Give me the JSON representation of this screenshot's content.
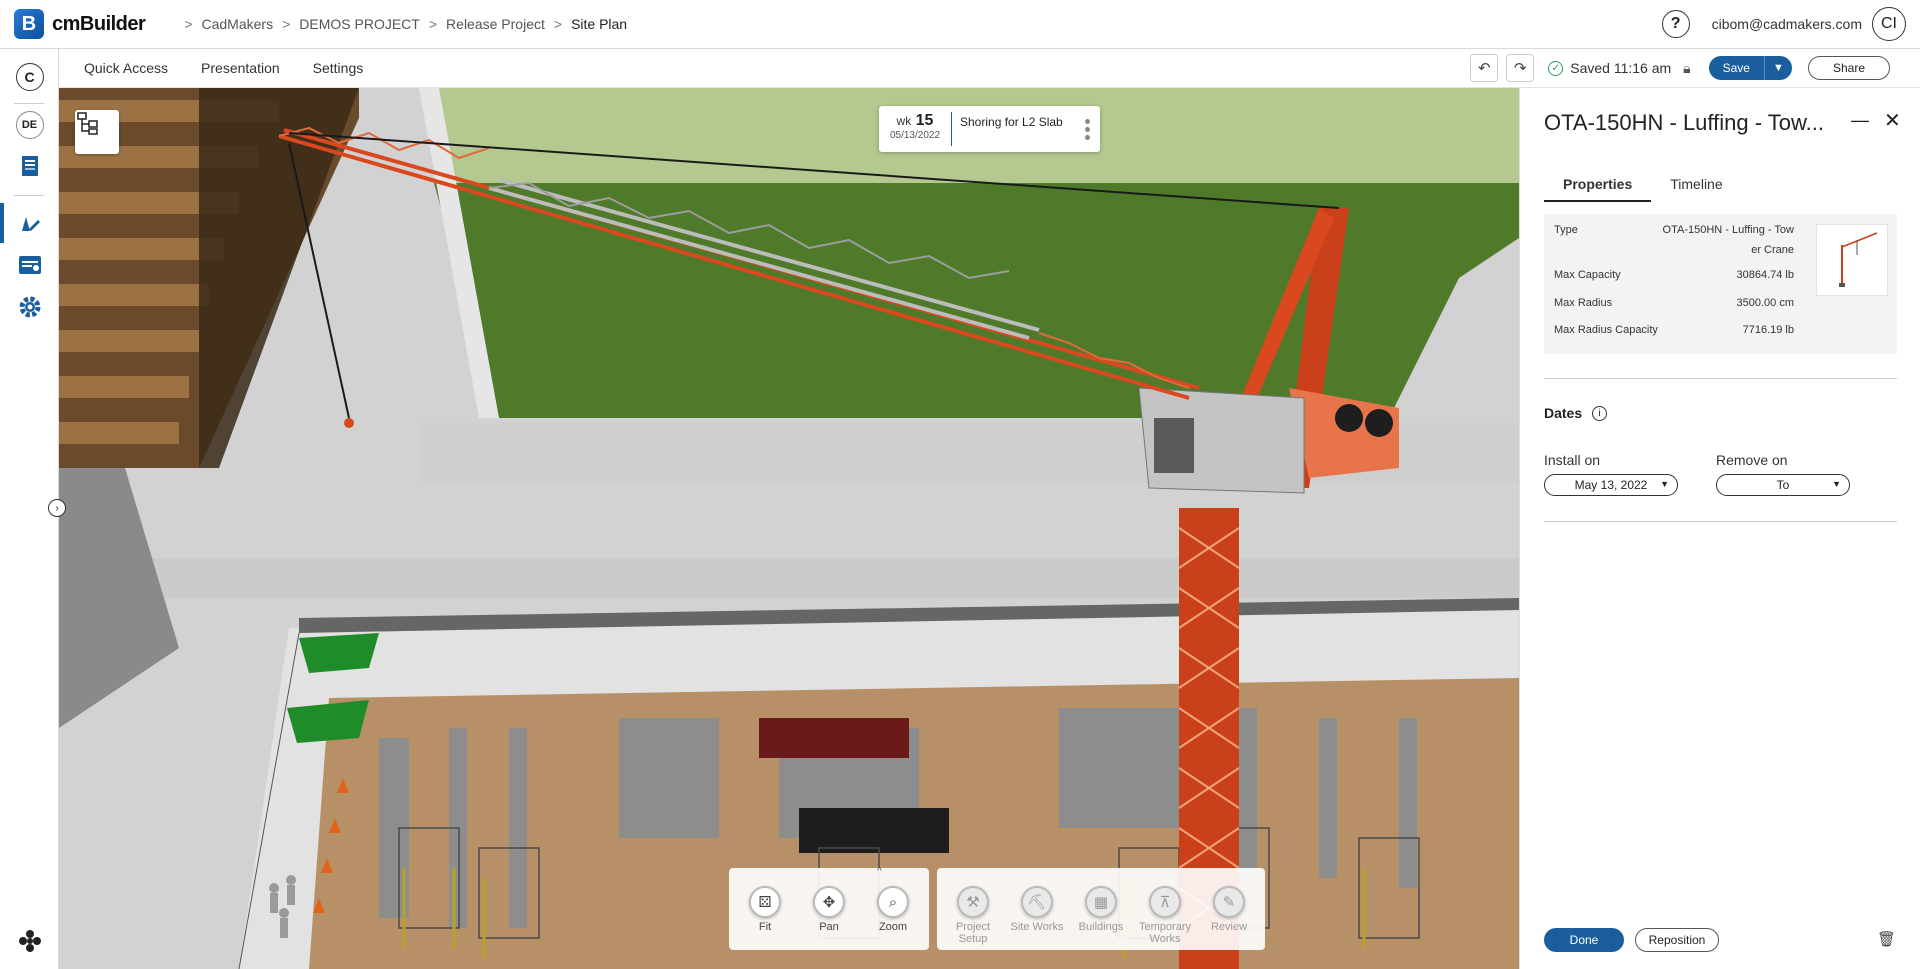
{
  "app": {
    "logo_letter": "B",
    "name": "cmBuilder"
  },
  "breadcrumb": [
    "CadMakers",
    "DEMOS PROJECT",
    "Release Project",
    "Site Plan"
  ],
  "user": {
    "email": "cibom@cadmakers.com",
    "initials": "CI",
    "help": "?"
  },
  "rail": {
    "company_initial": "C",
    "project_initials": "DE"
  },
  "toolbar": {
    "menus": [
      "Quick Access",
      "Presentation",
      "Settings"
    ],
    "saved_text": "Saved 11:16 am",
    "save_label": "Save",
    "share_label": "Share"
  },
  "week_card": {
    "wk_label": "wk",
    "week": "15",
    "date": "05/13/2022",
    "task": "Shoring for L2 Slab"
  },
  "bottom_tools": {
    "view": [
      {
        "label": "Fit",
        "icon": "fit-icon"
      },
      {
        "label": "Pan",
        "icon": "pan-icon"
      },
      {
        "label": "Zoom",
        "icon": "zoom-icon"
      }
    ],
    "modes": [
      {
        "label": "Project Setup",
        "icon": "tools-icon"
      },
      {
        "label": "Site Works",
        "icon": "excavator-icon"
      },
      {
        "label": "Buildings",
        "icon": "buildings-icon"
      },
      {
        "label": "Temporary Works",
        "icon": "crane-icon"
      },
      {
        "label": "Review",
        "icon": "review-icon"
      }
    ]
  },
  "panel": {
    "title": "OTA-150HN - Luffing - Tow...",
    "tabs": [
      "Properties",
      "Timeline"
    ],
    "properties": [
      {
        "key": "Type",
        "value": "OTA-150HN - Luffing - Tow\ner Crane"
      },
      {
        "key": "Max Capacity",
        "value": "30864.74 lb"
      },
      {
        "key": "Max Radius",
        "value": "3500.00 cm"
      },
      {
        "key": "Max Radius Capacity",
        "value": "7716.19 lb"
      }
    ],
    "dates_heading": "Dates",
    "install_label": "Install on",
    "install_value": "May 13, 2022",
    "remove_label": "Remove on",
    "remove_value": "To",
    "done_label": "Done",
    "reposition_label": "Reposition"
  },
  "colors": {
    "brand": "#1b5e9e",
    "crane": "#d9481f",
    "grass": "#4f7a2c",
    "saved_ok": "#2e9d5a"
  }
}
